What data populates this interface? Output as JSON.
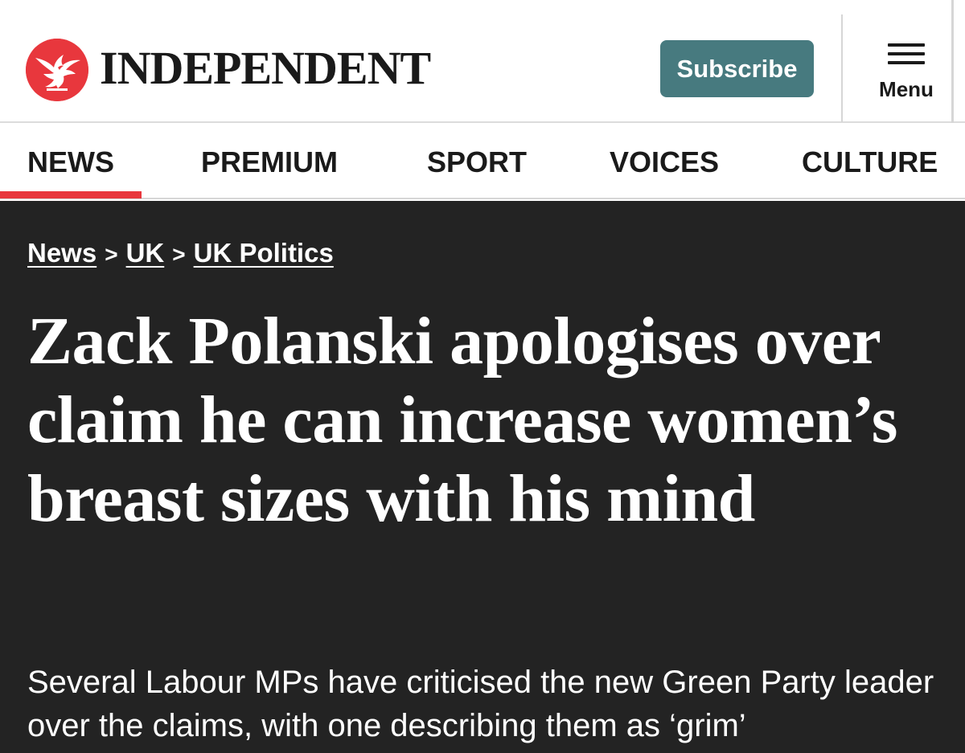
{
  "header": {
    "brand": "INDEPENDENT",
    "logo_icon": "eagle-logo-icon",
    "subscribe_label": "Subscribe",
    "menu_label": "Menu",
    "accent_color": "#e8373d",
    "subscribe_color": "#477a7f"
  },
  "nav": {
    "items": [
      {
        "label": "NEWS",
        "active": true
      },
      {
        "label": "PREMIUM",
        "active": false
      },
      {
        "label": "SPORT",
        "active": false
      },
      {
        "label": "VOICES",
        "active": false
      },
      {
        "label": "CULTURE",
        "active": false
      }
    ]
  },
  "article": {
    "breadcrumb": [
      {
        "label": "News"
      },
      {
        "label": "UK"
      },
      {
        "label": "UK Politics"
      }
    ],
    "breadcrumb_separator": ">",
    "headline": "Zack Polanski apologises over claim he can increase women’s breast sizes with his mind",
    "standfirst": "Several Labour MPs have criticised the new Green Party leader over the claims, with one describing them as ‘grim’",
    "background_color": "#232323"
  }
}
